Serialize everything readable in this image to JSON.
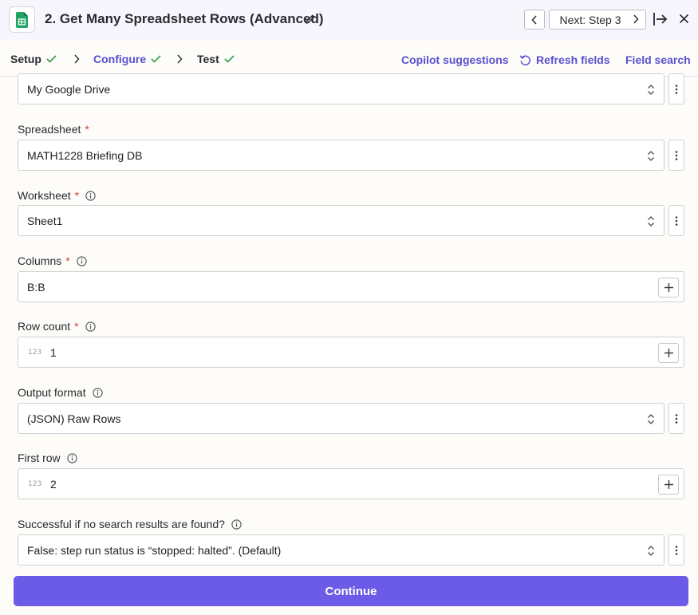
{
  "header": {
    "title": "2. Get Many Spreadsheet Rows (Advanced)",
    "next_label": "Next: Step 3",
    "app_icon": "google-sheets-icon"
  },
  "tabs": [
    {
      "label": "Setup",
      "done": true
    },
    {
      "label": "Configure",
      "done": true,
      "active": true
    },
    {
      "label": "Test",
      "done": true
    }
  ],
  "toolbar": {
    "copilot": "Copilot suggestions",
    "refresh": "Refresh fields",
    "field_search": "Field search"
  },
  "fields": {
    "drive": {
      "value": "My Google Drive"
    },
    "spreadsheet": {
      "label": "Spreadsheet",
      "required": "*",
      "value": "MATH1228 Briefing DB"
    },
    "worksheet": {
      "label": "Worksheet",
      "required": "*",
      "value": "Sheet1"
    },
    "columns": {
      "label": "Columns",
      "required": "*",
      "value": "B:B"
    },
    "row_count": {
      "label": "Row count",
      "required": "*",
      "prefix": "123",
      "value": "1"
    },
    "output_format": {
      "label": "Output format",
      "value": "(JSON) Raw Rows"
    },
    "first_row": {
      "label": "First row",
      "prefix": "123",
      "value": "2"
    },
    "success_if_none": {
      "label": "Successful if no search results are found?",
      "value": "False: step run status is “stopped: halted”. (Default)"
    }
  },
  "footer": {
    "continue_label": "Continue"
  },
  "colors": {
    "accent": "#6b5be6",
    "check": "#2e9d4a",
    "required": "#d6402f"
  }
}
